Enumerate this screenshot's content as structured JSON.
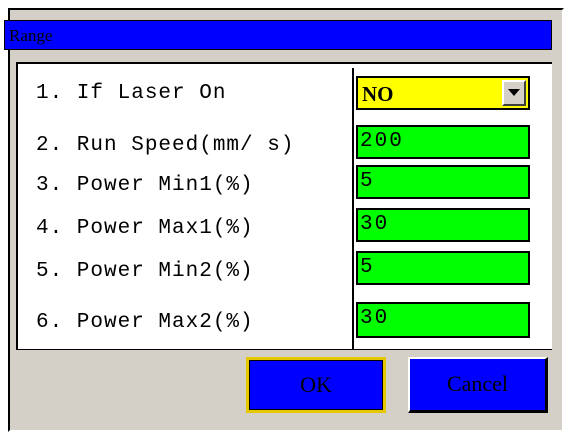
{
  "dialog": {
    "title": "Range",
    "rows": [
      {
        "label": "1. If Laser On",
        "value": "NO",
        "type": "select"
      },
      {
        "label": "2. Run Speed(mm/ s)",
        "value": "200",
        "type": "input"
      },
      {
        "label": "3. Power Min1(%)",
        "value": "5",
        "type": "input"
      },
      {
        "label": "4. Power Max1(%)",
        "value": "30",
        "type": "input"
      },
      {
        "label": "5. Power Min2(%)",
        "value": "5",
        "type": "input"
      },
      {
        "label": "6. Power Max2(%)",
        "value": "30",
        "type": "input"
      }
    ],
    "buttons": {
      "ok": "OK",
      "cancel": "Cancel"
    },
    "colors": {
      "title_bar": "#0000ff",
      "select_bg": "#ffff00",
      "input_bg": "#00ff00",
      "button_bg": "#0000ff",
      "focus_border": "#e6c800"
    },
    "icons": {
      "dropdown": "chevron-down-icon"
    }
  }
}
